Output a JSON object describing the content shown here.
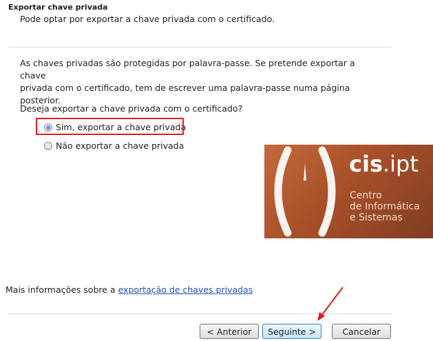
{
  "header": {
    "title": "Exportar chave privada",
    "subtitle": "Pode optar por exportar a chave privada com o certificado."
  },
  "body": {
    "paragraph_line1": "As chaves privadas são protegidas por palavra-passe. Se pretende exportar a chave",
    "paragraph_line2": "privada com o certificado, tem de escrever uma palavra-passe numa página posterior.",
    "question": "Deseja exportar a chave privada com o certificado?",
    "options": [
      {
        "label": "Sim, exportar a chave privada",
        "selected": true
      },
      {
        "label": "Não exportar a chave privada",
        "selected": false
      }
    ]
  },
  "logo": {
    "brand_bold": "cis",
    "brand_rest": ".ipt",
    "line1": "Centro",
    "line2": "de Informática",
    "line3": "e Sistemas"
  },
  "footer": {
    "more_info_prefix": "Mais informações sobre a",
    "more_info_link": "exportação de chaves privadas",
    "back_button": "< Anterior",
    "next_button": "Seguinte >",
    "cancel_button": "Cancelar"
  },
  "colors": {
    "highlight": "#e21b23",
    "arrow": "#e21b23",
    "link": "#1a4fb5"
  }
}
